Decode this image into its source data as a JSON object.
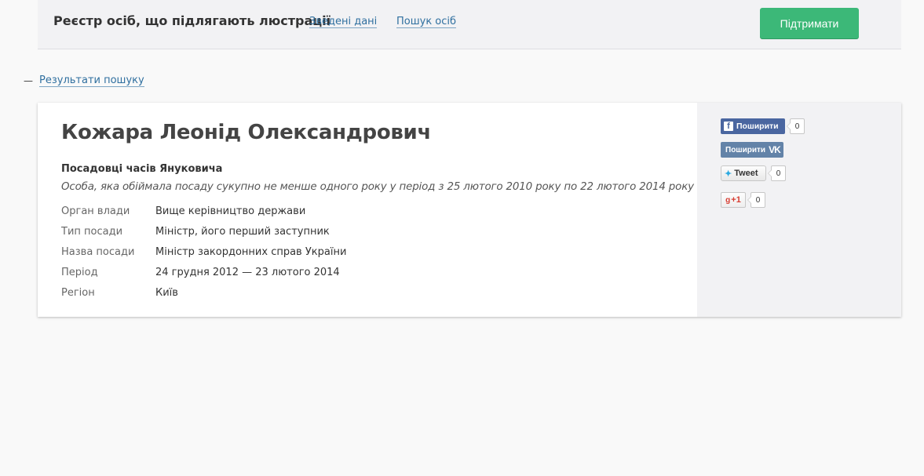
{
  "header": {
    "title": "Реєстр осіб, що підлягають люстрації",
    "nav": [
      {
        "label": "Зведені дані"
      },
      {
        "label": "Пошук осіб"
      }
    ],
    "support_label": "Підтримати"
  },
  "breadcrumb": {
    "dash": "—",
    "back_label": "Результати пошуку"
  },
  "person": {
    "name": "Кожара Леонід Олександрович",
    "category": "Посадовці часів Януковича",
    "category_description": "Особа, яка обіймала посаду сукупно не менше одного року у період з 25 лютого 2010 року по 22 лютого 2014 року",
    "details": [
      {
        "label": "Орган влади",
        "value": "Вище керівництво держави"
      },
      {
        "label": "Тип посади",
        "value": "Міністр, його перший заступник"
      },
      {
        "label": "Назва посади",
        "value": "Міністр закордонних справ України"
      },
      {
        "label": "Період",
        "value": "24 грудня 2012 — 23 лютого 2014"
      },
      {
        "label": "Регіон",
        "value": "Київ"
      }
    ]
  },
  "share": {
    "facebook": {
      "icon": "facebook-icon",
      "label": "Поширити",
      "count": "0"
    },
    "vk": {
      "icon": "vk-icon",
      "label": "Поширити"
    },
    "twitter": {
      "icon": "twitter-icon",
      "label": "Tweet",
      "count": "0"
    },
    "gplus": {
      "icon": "gplus-icon",
      "label": "+1",
      "count": "0"
    }
  },
  "colors": {
    "support_button": "#3cb878",
    "link": "#2f6f9f",
    "facebook": "#4a66a0",
    "vk": "#6383a8"
  }
}
